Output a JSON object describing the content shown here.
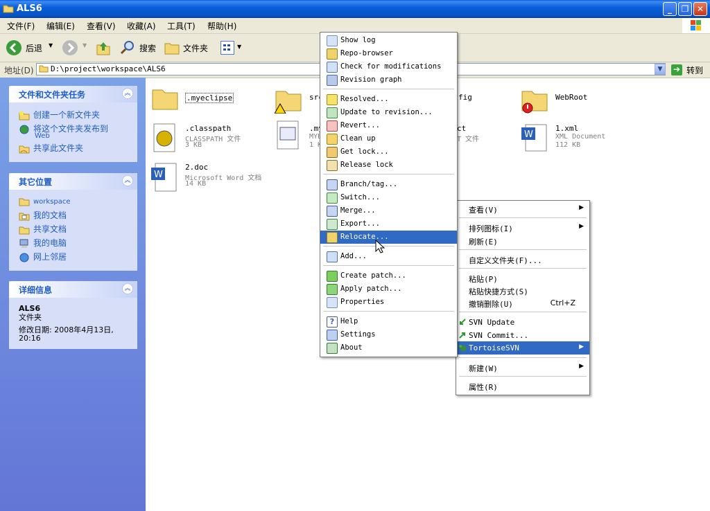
{
  "window": {
    "title": "ALS6"
  },
  "menu": [
    "文件(F)",
    "编辑(E)",
    "查看(V)",
    "收藏(A)",
    "工具(T)",
    "帮助(H)"
  ],
  "toolbar": {
    "back": "后退",
    "search": "搜索",
    "folders": "文件夹"
  },
  "address": {
    "label": "地址(D)",
    "path": "D:\\project\\workspace\\ALS6",
    "go": "转到"
  },
  "left_pane": {
    "tasks": {
      "title": "文件和文件夹任务",
      "items": [
        "创建一个新文件夹",
        "将这个文件夹发布到",
        "Web",
        "共享此文件夹"
      ]
    },
    "places": {
      "title": "其它位置",
      "items": [
        "workspace",
        "我的文档",
        "共享文档",
        "我的电脑",
        "网上邻居"
      ]
    },
    "details": {
      "title": "详细信息",
      "name": "ALS6",
      "type": "文件夹",
      "modified": "修改日期: 2008年4月13日,",
      "time": "20:16"
    }
  },
  "files": [
    {
      "name": ".myeclipse"
    },
    {
      "name": "src"
    },
    {
      "name": "fig"
    },
    {
      "name": "WebRoot"
    },
    {
      "name": ".classpath",
      "type": "CLASSPATH 文件",
      "size": "3 KB"
    },
    {
      "name": ".my",
      "type": "MYE",
      "size": "1 K"
    },
    {
      "name": "ct",
      "type": "T 文件"
    },
    {
      "name": "1.xml",
      "type": "XML Document",
      "size": "112 KB"
    },
    {
      "name": "2.doc",
      "type": "Microsoft Word 文档",
      "size": "14 KB"
    }
  ],
  "svn_menu": [
    "Show log",
    "Repo-browser",
    "Check for modifications",
    "Revision graph",
    "Resolved...",
    "Update to revision...",
    "Revert...",
    "Clean up",
    "Get lock...",
    "Release lock",
    "Branch/tag...",
    "Switch...",
    "Merge...",
    "Export...",
    "Relocate...",
    "Add...",
    "Create patch...",
    "Apply patch...",
    "Properties",
    "Help",
    "Settings",
    "About"
  ],
  "ctx_menu": {
    "view": "查看(V)",
    "arrange": "排列图标(I)",
    "refresh": "刷新(E)",
    "customize": "自定义文件夹(F)...",
    "paste": "粘贴(P)",
    "paste_shortcut": "粘贴快捷方式(S)",
    "undo_delete": "撤销删除(U)",
    "undo_shortcut": "Ctrl+Z",
    "svn_update": "SVN Update",
    "svn_commit": "SVN Commit...",
    "tortoise": "TortoiseSVN",
    "new": "新建(W)",
    "properties": "属性(R)"
  },
  "colors": {
    "accent": "#316ac5",
    "titlebar": "#0b5fd9",
    "sidepane": "#6f8ddc"
  }
}
